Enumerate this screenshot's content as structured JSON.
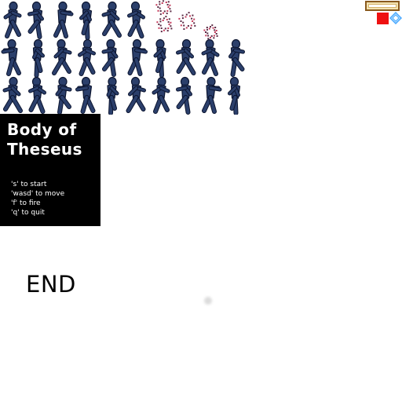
{
  "game": {
    "title_line1": "Body of",
    "title_line2": "Theseus",
    "controls": [
      "'s' to start",
      "'wasd' to move",
      "'f' to fire",
      "'q' to quit"
    ],
    "end_label": "END"
  },
  "sprite_sheet": {
    "figure_color": "#2b3f6b",
    "outline_color": "#0c1530",
    "particle_color": "#5a2a44",
    "rows": 3,
    "figures_per_row": 10
  },
  "hud": {
    "health_bar_icon": "health-bar-frame",
    "red_block_color": "#ee1111",
    "gem_icon": "blue-gem-icon",
    "gem_color": "#4aa8ff"
  },
  "panel": {
    "background": "#000000",
    "text_color": "#ffffff"
  }
}
